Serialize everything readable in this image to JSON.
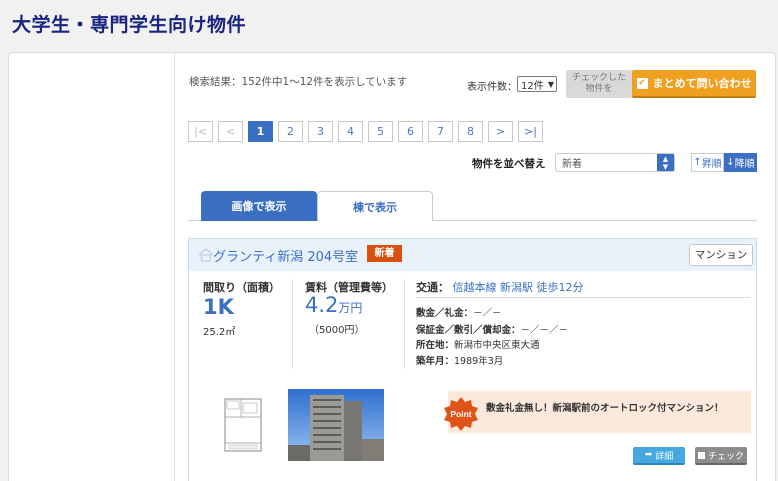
{
  "page": {
    "title": "大学生・専門学生向け物件"
  },
  "results": {
    "summary": "検索結果：152件中1～12件を表示しています",
    "count_label": "表示件数：",
    "count_value": "12件",
    "checked_label_line1": "チェックした",
    "checked_label_line2": "物件を",
    "inquire_label": "まとめて問い合わせ"
  },
  "pager": {
    "first": "|<",
    "prev": "<",
    "pages": [
      "1",
      "2",
      "3",
      "4",
      "5",
      "6",
      "7",
      "8"
    ],
    "current": "1",
    "next": ">",
    "last": ">|"
  },
  "sort": {
    "label": "物件を並べ替え",
    "value": "新着",
    "asc_label": "昇順",
    "desc_label": "降順"
  },
  "tabs": [
    {
      "label": "画像で表示",
      "active": true
    },
    {
      "label": "棟で表示",
      "active": false
    }
  ],
  "listing": {
    "name": "グランティ新潟 204号室",
    "new_badge": "新着",
    "type": "マンション",
    "layout_label": "間取り（面積）",
    "layout": "1K",
    "area": "25.2㎡",
    "rent_label": "賃料（管理費等）",
    "rent": "4.2",
    "rent_unit": "万円",
    "fee": "（5000円）",
    "access_label": "交通：",
    "access_value": "信越本線 新潟駅 徒歩12分",
    "deposit_label": "敷金／礼金：",
    "deposit_value": "－／－",
    "guarantee_label": "保証金／敷引／償却金：",
    "guarantee_value": "－／－／－",
    "address_label": "所在地：",
    "address_value": "新潟市中央区東大通",
    "built_label": "築年月：",
    "built_value": "1989年3月",
    "point_badge": "Point",
    "point_text": "敷金礼金無し！新潟駅前のオートロック付マンション！",
    "detail_label": "詳細",
    "check_label": "チェック"
  },
  "colors": {
    "accent_blue": "#3b6fc4",
    "title_navy": "#1a237e",
    "orange": "#f0a020",
    "new_red": "#d9500f",
    "point_bg": "#fde9dc"
  }
}
